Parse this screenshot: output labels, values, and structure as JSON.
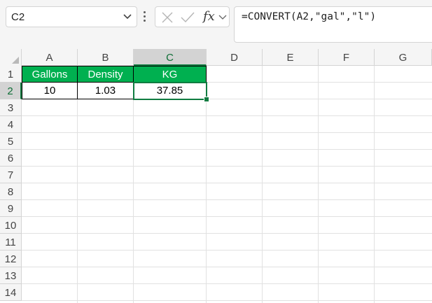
{
  "name_box": {
    "value": "C2"
  },
  "formula_bar": {
    "fx_label": "fx",
    "formula": "=CONVERT(A2,\"gal\",\"l\")"
  },
  "columns": [
    "A",
    "B",
    "C",
    "D",
    "E",
    "F",
    "G"
  ],
  "rows": [
    "1",
    "2",
    "3",
    "4",
    "5",
    "6",
    "7",
    "8",
    "9",
    "10",
    "11",
    "12",
    "13",
    "14"
  ],
  "cells": {
    "A1": "Gallons",
    "B1": "Density",
    "C1": "KG",
    "A2": "10",
    "B2": "1.03",
    "C2": "37.85"
  },
  "selection": {
    "cell": "C2",
    "column": "C",
    "row": "2"
  },
  "colors": {
    "header_fill": "#00b050",
    "accent": "#107c41"
  }
}
